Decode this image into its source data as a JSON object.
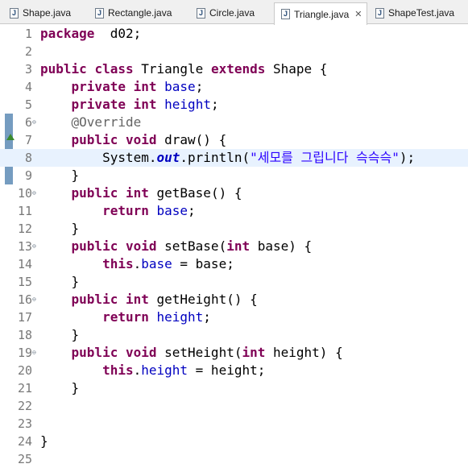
{
  "tabs": [
    {
      "label": "Shape.java",
      "active": false
    },
    {
      "label": "Rectangle.java",
      "active": false
    },
    {
      "label": "Circle.java",
      "active": false
    },
    {
      "label": "Triangle.java",
      "active": true
    },
    {
      "label": "ShapeTest.java",
      "active": false
    }
  ],
  "editor": {
    "current_line": 8,
    "lines": [
      {
        "n": "1",
        "tokens": [
          [
            "kw",
            "package"
          ],
          [
            "",
            "  d02;"
          ]
        ]
      },
      {
        "n": "2",
        "tokens": []
      },
      {
        "n": "3",
        "tokens": [
          [
            "kw",
            "public"
          ],
          [
            "",
            " "
          ],
          [
            "kw",
            "class"
          ],
          [
            "",
            " Triangle "
          ],
          [
            "kw",
            "extends"
          ],
          [
            "",
            " Shape {"
          ]
        ]
      },
      {
        "n": "4",
        "tokens": [
          [
            "",
            "    "
          ],
          [
            "kw",
            "private"
          ],
          [
            "",
            " "
          ],
          [
            "kw",
            "int"
          ],
          [
            "",
            " "
          ],
          [
            "fld",
            "base"
          ],
          [
            "",
            ";"
          ]
        ]
      },
      {
        "n": "5",
        "tokens": [
          [
            "",
            "    "
          ],
          [
            "kw",
            "private"
          ],
          [
            "",
            " "
          ],
          [
            "kw",
            "int"
          ],
          [
            "",
            " "
          ],
          [
            "fld",
            "height"
          ],
          [
            "",
            ";"
          ]
        ]
      },
      {
        "n": "6",
        "fold": true,
        "tokens": [
          [
            "",
            "    "
          ],
          [
            "ann",
            "@Override"
          ]
        ]
      },
      {
        "n": "7",
        "tokens": [
          [
            "",
            "    "
          ],
          [
            "kw",
            "public"
          ],
          [
            "",
            " "
          ],
          [
            "kw",
            "void"
          ],
          [
            "",
            " draw() {"
          ]
        ]
      },
      {
        "n": "8",
        "tokens": [
          [
            "",
            "        System."
          ],
          [
            "stat",
            "out"
          ],
          [
            "",
            ".println("
          ],
          [
            "str",
            "\"세모를 그립니다 슥슥슥\""
          ],
          [
            "",
            ");"
          ]
        ]
      },
      {
        "n": "9",
        "tokens": [
          [
            "",
            "    }"
          ]
        ]
      },
      {
        "n": "10",
        "fold": true,
        "tokens": [
          [
            "",
            "    "
          ],
          [
            "kw",
            "public"
          ],
          [
            "",
            " "
          ],
          [
            "kw",
            "int"
          ],
          [
            "",
            " getBase() {"
          ]
        ]
      },
      {
        "n": "11",
        "tokens": [
          [
            "",
            "        "
          ],
          [
            "kw",
            "return"
          ],
          [
            "",
            " "
          ],
          [
            "fld",
            "base"
          ],
          [
            "",
            ";"
          ]
        ]
      },
      {
        "n": "12",
        "tokens": [
          [
            "",
            "    }"
          ]
        ]
      },
      {
        "n": "13",
        "fold": true,
        "tokens": [
          [
            "",
            "    "
          ],
          [
            "kw",
            "public"
          ],
          [
            "",
            " "
          ],
          [
            "kw",
            "void"
          ],
          [
            "",
            " setBase("
          ],
          [
            "kw",
            "int"
          ],
          [
            "",
            " base) {"
          ]
        ]
      },
      {
        "n": "14",
        "tokens": [
          [
            "",
            "        "
          ],
          [
            "kw",
            "this"
          ],
          [
            "",
            "."
          ],
          [
            "fld",
            "base"
          ],
          [
            "",
            " = base;"
          ]
        ]
      },
      {
        "n": "15",
        "tokens": [
          [
            "",
            "    }"
          ]
        ]
      },
      {
        "n": "16",
        "fold": true,
        "tokens": [
          [
            "",
            "    "
          ],
          [
            "kw",
            "public"
          ],
          [
            "",
            " "
          ],
          [
            "kw",
            "int"
          ],
          [
            "",
            " getHeight() {"
          ]
        ]
      },
      {
        "n": "17",
        "tokens": [
          [
            "",
            "        "
          ],
          [
            "kw",
            "return"
          ],
          [
            "",
            " "
          ],
          [
            "fld",
            "height"
          ],
          [
            "",
            ";"
          ]
        ]
      },
      {
        "n": "18",
        "tokens": [
          [
            "",
            "    }"
          ]
        ]
      },
      {
        "n": "19",
        "fold": true,
        "tokens": [
          [
            "",
            "    "
          ],
          [
            "kw",
            "public"
          ],
          [
            "",
            " "
          ],
          [
            "kw",
            "void"
          ],
          [
            "",
            " setHeight("
          ],
          [
            "kw",
            "int"
          ],
          [
            "",
            " height) {"
          ]
        ]
      },
      {
        "n": "20",
        "tokens": [
          [
            "",
            "        "
          ],
          [
            "kw",
            "this"
          ],
          [
            "",
            "."
          ],
          [
            "fld",
            "height"
          ],
          [
            "",
            " = height;"
          ]
        ]
      },
      {
        "n": "21",
        "tokens": [
          [
            "",
            "    }"
          ]
        ]
      },
      {
        "n": "22",
        "tokens": []
      },
      {
        "n": "23",
        "tokens": []
      },
      {
        "n": "24",
        "tokens": [
          [
            "",
            "}"
          ]
        ]
      },
      {
        "n": "25",
        "tokens": []
      }
    ]
  }
}
